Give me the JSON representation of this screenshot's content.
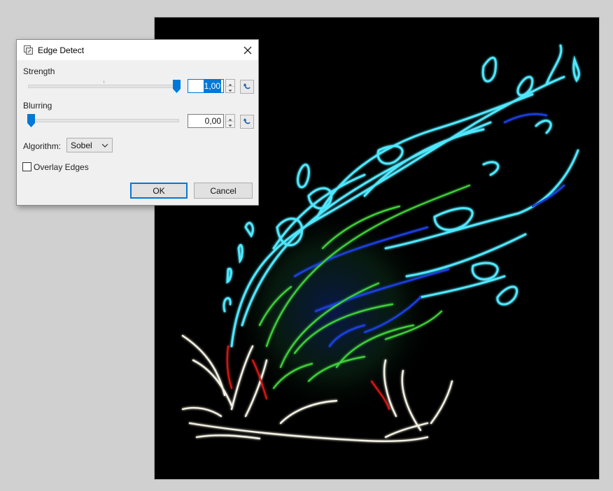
{
  "dialog": {
    "title": "Edge Detect",
    "strength": {
      "label": "Strength",
      "value": "1,00",
      "fraction": 1.0
    },
    "blurring": {
      "label": "Blurring",
      "value": "0,00",
      "fraction": 0.0
    },
    "algorithm": {
      "label": "Algorithm:",
      "selected": "Sobel"
    },
    "overlay_edges": {
      "label": "Overlay Edges",
      "checked": false
    },
    "ok_label": "OK",
    "cancel_label": "Cancel"
  },
  "icons": {
    "title": "edge-detect-effect-icon",
    "close": "close-icon",
    "reset": "reset-arrow-icon",
    "spin_up": "chevron-up-icon",
    "spin_down": "chevron-down-icon",
    "combo": "chevron-down-icon"
  },
  "colors": {
    "accent": "#0078d7",
    "canvas_background": "#000000",
    "edge_cyan": "#4fe8ff",
    "edge_green": "#3fd23a",
    "edge_blue": "#1a3fe0",
    "edge_white": "#f4f2e4",
    "edge_red": "#d81818"
  }
}
